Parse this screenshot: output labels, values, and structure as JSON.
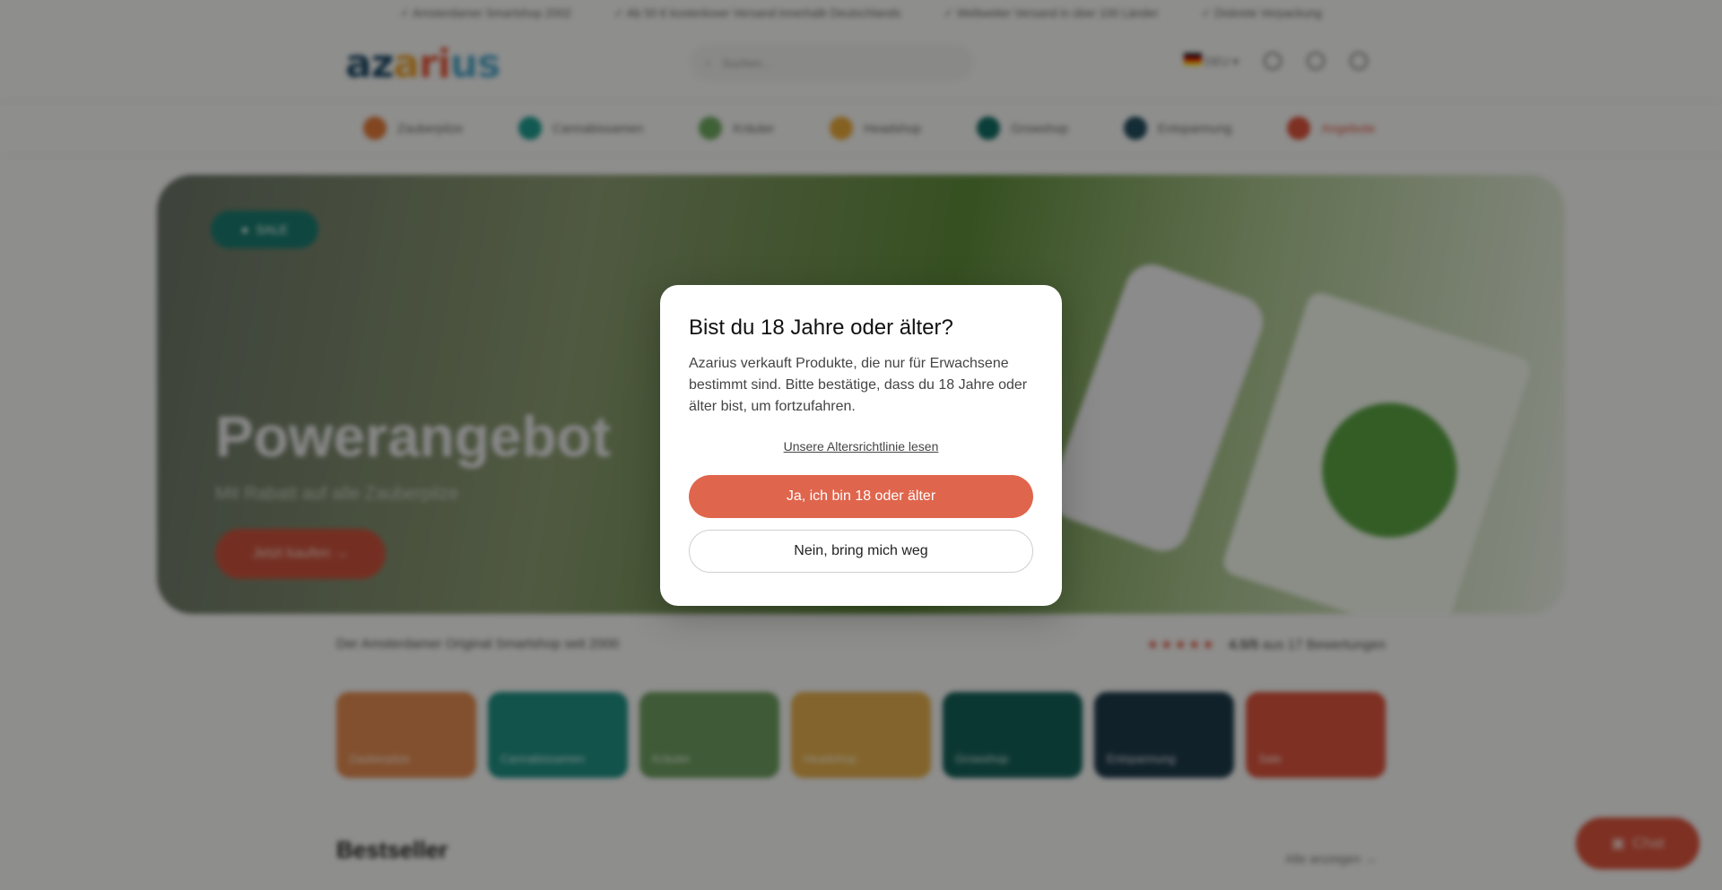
{
  "topbar": {
    "items": [
      "Amsterdamer Smartshop 2002",
      "Ab 50 € kostenloser Versand innerhalb Deutschlands",
      "Weltweiter Versand in über 100 Länder",
      "Diskrete Verpackung"
    ]
  },
  "header": {
    "logo": {
      "a1": "az",
      "a2": "a",
      "a3": "ri",
      "a4": "us"
    },
    "search_placeholder": "Suchen...",
    "language": "DEU"
  },
  "nav": {
    "items": [
      {
        "label": "Zauberpilze",
        "color": "#e07a3a"
      },
      {
        "label": "Cannabissamen",
        "color": "#1f9a8e"
      },
      {
        "label": "Kräuter",
        "color": "#6fa860"
      },
      {
        "label": "Headshop",
        "color": "#e6a83a"
      },
      {
        "label": "Growshop",
        "color": "#126b62"
      },
      {
        "label": "Entspannung",
        "color": "#234c5e"
      },
      {
        "label": "Angebote",
        "color": "#d9533c"
      }
    ]
  },
  "hero": {
    "badge": "SALE",
    "title": "Powerangebot",
    "subtitle": "Mit Rabatt auf alle Zauberpilze",
    "cta": "Jetzt kaufen →"
  },
  "trust": {
    "tagline": "Der Amsterdamer Original Smartshop seit 2000",
    "stars": "★★★★★",
    "rating": "4.5/5",
    "reviews": "aus 17 Bewertungen"
  },
  "categories": [
    {
      "label": "Zauberpilze",
      "color": "#e08a50"
    },
    {
      "label": "Cannabissamen",
      "color": "#1f8f82"
    },
    {
      "label": "Kräuter",
      "color": "#6c9c5e"
    },
    {
      "label": "Headshop",
      "color": "#e2ad4c"
    },
    {
      "label": "Growshop",
      "color": "#145f57"
    },
    {
      "label": "Entspannung",
      "color": "#1e3a49"
    },
    {
      "label": "Sale",
      "color": "#d9533c"
    }
  ],
  "bestseller": {
    "title": "Bestseller",
    "view_all": "Alle anzeigen →"
  },
  "chat": {
    "label": "Chat"
  },
  "modal": {
    "title": "Bist du 18 Jahre oder älter?",
    "body": "Azarius verkauft Produkte, die nur für Erwachsene bestimmt sind. Bitte bestätige, dass du 18 Jahre oder älter bist, um fortzufahren.",
    "policy_link": "Unsere Altersrichtlinie lesen",
    "confirm": "Ja, ich bin 18 oder älter",
    "decline": "Nein, bring mich weg"
  }
}
